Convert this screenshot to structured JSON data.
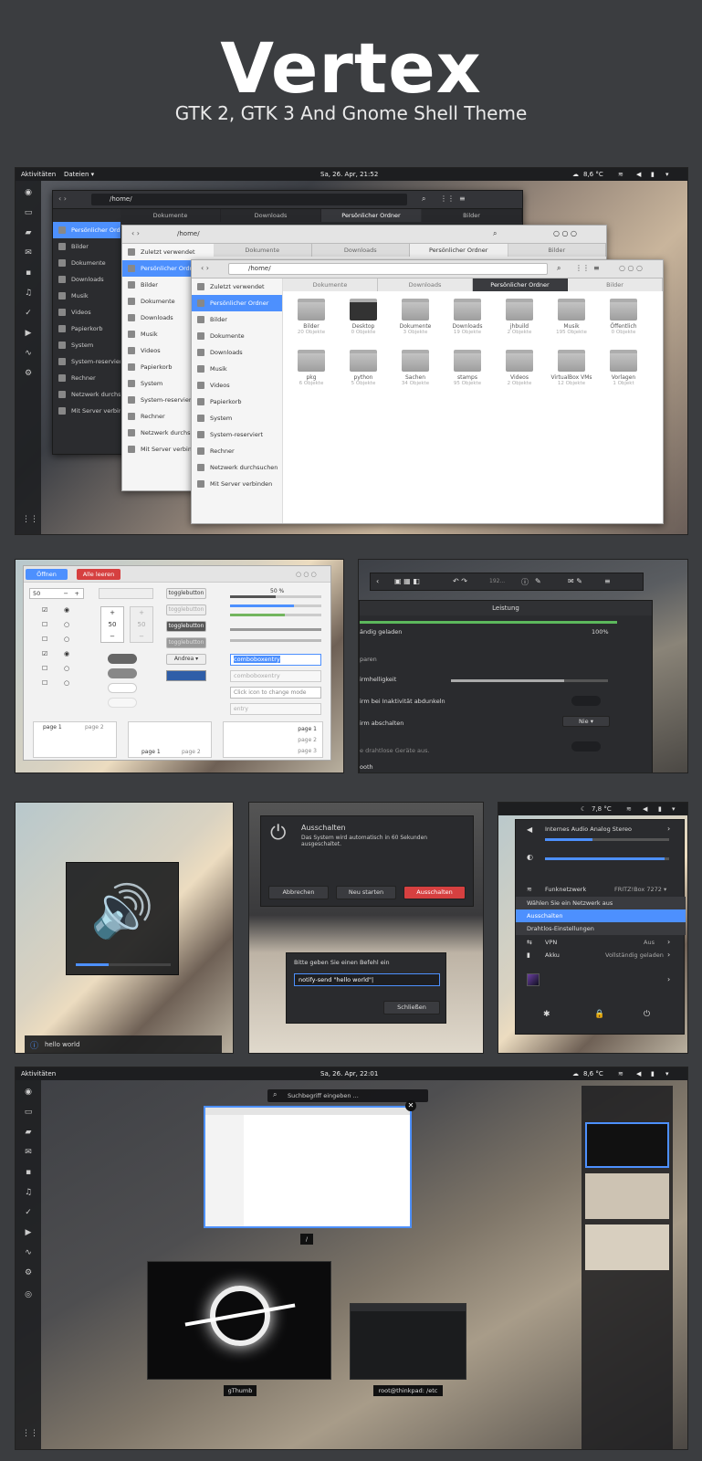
{
  "hero": {
    "title": "Vertex",
    "subtitle": "GTK 2, GTK 3 And Gnome Shell Theme"
  },
  "top": {
    "activities": "Aktivitäten",
    "files_menu": "Dateien ▾",
    "clock": "Sa, 26. Apr, 21:52",
    "weather": "8,6 °C",
    "path": "/home/",
    "tabs": [
      "Dokumente",
      "Downloads",
      "Persönlicher Ordner",
      "Bilder"
    ],
    "sidebar": [
      "Zuletzt verwendet",
      "Persönlicher Ordner",
      "Bilder",
      "Dokumente",
      "Downloads",
      "Musik",
      "Videos",
      "Papierkorb",
      "System",
      "System-reserviert",
      "Rechner",
      "Netzwerk durchsuchen",
      "Mit Server verbinden"
    ],
    "sidebar_dark": [
      "Persönlicher Ordner",
      "Bilder",
      "Dokumente",
      "Downloads",
      "Musik",
      "Videos",
      "Papierkorb",
      "System",
      "System-reserviert",
      "Rechner",
      "Netzwerk durchsuchen",
      "Mit Server verbinden"
    ],
    "folders": [
      {
        "name": "Bilder",
        "count": "20 Objekte"
      },
      {
        "name": "Desktop",
        "count": "0 Objekte"
      },
      {
        "name": "Dokumente",
        "count": "3 Objekte"
      },
      {
        "name": "Downloads",
        "count": "19 Objekte"
      },
      {
        "name": "jhbuild",
        "count": "2 Objekte"
      },
      {
        "name": "Musik",
        "count": "195 Objekte"
      },
      {
        "name": "Öffentlich",
        "count": "0 Objekte"
      },
      {
        "name": "pkg",
        "count": "6 Objekte"
      },
      {
        "name": "python",
        "count": "5 Objekte"
      },
      {
        "name": "Sachen",
        "count": "34 Objekte"
      },
      {
        "name": "stamps",
        "count": "95 Objekte"
      },
      {
        "name": "Videos",
        "count": "2 Objekte"
      },
      {
        "name": "VirtualBox VMs",
        "count": "12 Objekte"
      },
      {
        "name": "Vorlagen",
        "count": "1 Objekt"
      }
    ]
  },
  "widgets": {
    "open": "Öffnen",
    "clear": "Alle leeren",
    "spin_value": "50",
    "vspin_value": "50",
    "vspin_dim": "50",
    "toggle": "togglebutton",
    "andrea": "Andrea ▾",
    "combo": "comboboxentry",
    "combo2": "comboboxentry",
    "icon_entry": "Click icon to change mode",
    "entry": "entry",
    "percent": "50 %",
    "page1": "page 1",
    "page2": "page 2",
    "page3": "page 3"
  },
  "power": {
    "title": "Leistung",
    "charged": "ändig geladen",
    "charged_pct": "100%",
    "saving": "paren",
    "brightness": "irmhelligkeit",
    "dim": "irm bei Inaktivität abdunkeln",
    "off": "irm abschalten",
    "never": "Nie ▾",
    "wireless": "e drahtlose Geräte aus.",
    "bt": "ooth",
    "zoom": "192..."
  },
  "notify": {
    "text": "hello world"
  },
  "shutdown": {
    "title": "Ausschalten",
    "body": "Das System wird automatisch in 60 Sekunden ausgeschaltet.",
    "cancel": "Abbrechen",
    "restart": "Neu starten",
    "power_off": "Ausschalten"
  },
  "run": {
    "title": "Bitte geben Sie einen Befehl ein",
    "command": "notify-send \"hello world\"|",
    "close": "Schließen"
  },
  "menu": {
    "weather": "7,8 °C",
    "audio": "Internes Audio Analog Stereo",
    "network": "Funknetzwerk",
    "ssid": "FRITZ!Box 7272 ▾",
    "choose": "Wählen Sie ein Netzwerk aus",
    "off": "Ausschalten",
    "settings": "Drahtlos-Einstellungen",
    "vpn": "VPN",
    "vpn_state": "Aus",
    "battery": "Akku",
    "battery_state": "Vollständig geladen"
  },
  "overview": {
    "activities": "Aktivitäten",
    "clock": "Sa, 26. Apr, 22:01",
    "weather": "8,6 °C",
    "search": "Suchbegriff eingeben ...",
    "cap1": "/",
    "cap2": "gThumb",
    "cap3": "root@thinkpad: /etc"
  },
  "colors": {
    "accent": "#4d90fe",
    "red": "#d64040",
    "bg": "#3b3d40"
  }
}
